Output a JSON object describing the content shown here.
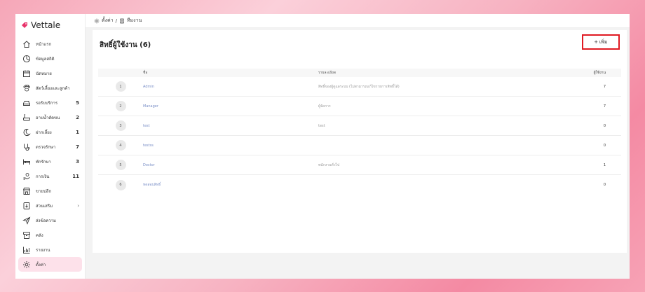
{
  "app": {
    "name": "Vettale",
    "brand_color": "#e8336b"
  },
  "breadcrumb": {
    "parent": "ตั้งค่า",
    "separator": "/",
    "current": "ทีมงาน"
  },
  "sidebar": {
    "items": [
      {
        "label": "หน้าแรก",
        "icon": "home-icon",
        "count": ""
      },
      {
        "label": "ข้อมูลสถิติ",
        "icon": "chart-circle-icon",
        "count": ""
      },
      {
        "label": "นัดหมาย",
        "icon": "calendar-icon",
        "count": ""
      },
      {
        "label": "สัตว์เลี้ยงและลูกค้า",
        "icon": "paw-icon",
        "count": ""
      },
      {
        "label": "รอรับบริการ",
        "icon": "sofa-icon",
        "count": "5"
      },
      {
        "label": "อาบน้ำตัดขน",
        "icon": "bath-icon",
        "count": "2"
      },
      {
        "label": "ฝากเลี้ยง",
        "icon": "moon-icon",
        "count": "1"
      },
      {
        "label": "ตรวจรักษา",
        "icon": "stethoscope-icon",
        "count": "7"
      },
      {
        "label": "พักรักษา",
        "icon": "bed-icon",
        "count": "3"
      },
      {
        "label": "การเงิน",
        "icon": "money-hand-icon",
        "count": "11"
      },
      {
        "label": "ขายปลีก",
        "icon": "shop-icon",
        "count": ""
      },
      {
        "label": "ส่วนเสริม",
        "icon": "plugin-icon",
        "count": "",
        "chevron": "›"
      },
      {
        "label": "ส่งข้อความ",
        "icon": "send-icon",
        "count": ""
      },
      {
        "label": "คลัง",
        "icon": "box-icon",
        "count": ""
      },
      {
        "label": "รายงาน",
        "icon": "report-icon",
        "count": ""
      },
      {
        "label": "ตั้งค่า",
        "icon": "gear-icon",
        "count": "",
        "active": true
      }
    ]
  },
  "page": {
    "title": "สิทธิ์ผู้ใช้งาน (6)",
    "add_button": {
      "icon": "+",
      "label": "เพิ่ม"
    }
  },
  "table": {
    "headers": {
      "num": "",
      "name": "ชื่อ",
      "desc": "รายละเอียด",
      "users": "ผู้ใช้งาน"
    },
    "rows": [
      {
        "num": "1",
        "name": "Admin",
        "desc": "สิทธิ์ของผู้ดูแลระบบ (ไม่สามารถแก้ไขรายการสิทธิ์ได้)",
        "users": "7"
      },
      {
        "num": "2",
        "name": "Manager",
        "desc": "ผู้จัดการ",
        "users": "7"
      },
      {
        "num": "3",
        "name": "test",
        "desc": "test",
        "users": "0"
      },
      {
        "num": "4",
        "name": "testss",
        "desc": "",
        "users": "0"
      },
      {
        "num": "5",
        "name": "Doctor",
        "desc": "พนักงานทั่วไป",
        "users": "1"
      },
      {
        "num": "6",
        "name": "ทดสอบสิทธิ์",
        "desc": "",
        "users": "0"
      }
    ]
  }
}
